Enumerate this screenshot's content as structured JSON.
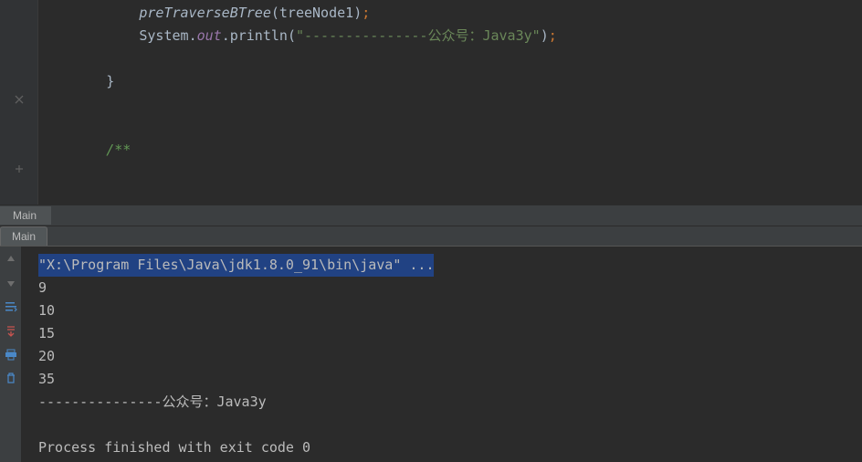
{
  "code": {
    "line1_indent": "            ",
    "line1_call": "preTraverseBTree",
    "line1_arg": "treeNode1",
    "line2_indent": "            ",
    "line2_sys": "System",
    "line2_out": "out",
    "line2_println": "println",
    "line2_str": "\"---------------公众号：Java3y\"",
    "line4_indent": "        ",
    "line4_brace": "}",
    "line7_indent": "        ",
    "line7_comment": "/**"
  },
  "tabs": {
    "outer": "Main",
    "inner": "Main"
  },
  "console": {
    "cmd": "\"X:\\Program Files\\Java\\jdk1.8.0_91\\bin\\java\" ...",
    "out1": "9",
    "out2": "10",
    "out3": "15",
    "out4": "20",
    "out5": "35",
    "out6": "---------------公众号：Java3y",
    "out7": "",
    "out8": "Process finished with exit code 0"
  },
  "icons": {
    "up": "up-arrow",
    "down": "down-arrow",
    "wrap": "soft-wrap",
    "scroll": "scroll-to-end",
    "print": "print",
    "clear": "clear-all"
  }
}
